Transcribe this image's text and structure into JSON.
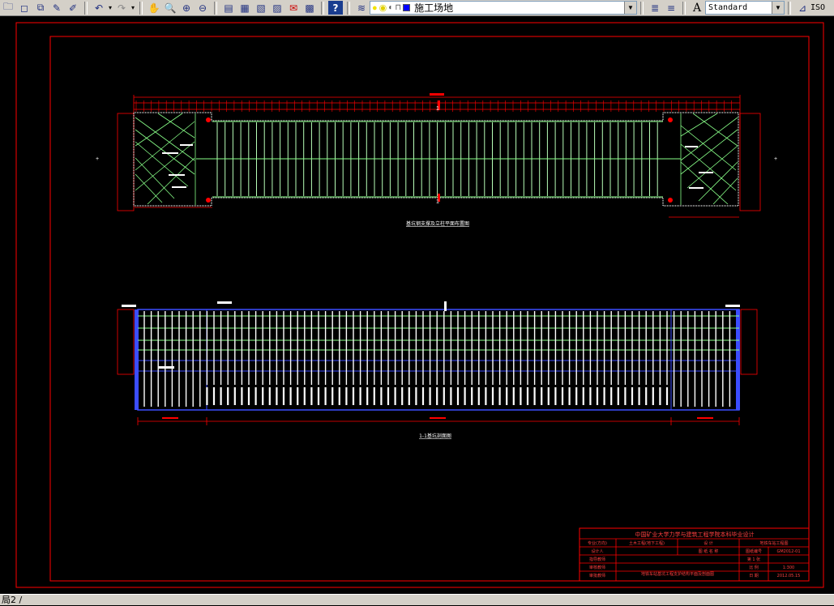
{
  "toolbar": {
    "layer_name": "施工场地",
    "text_style": "Standard",
    "dim_style": "ISO",
    "colors": {
      "bulb": "#f2e200",
      "sun": "#e0d000",
      "swatch": "#0000ff"
    }
  },
  "drawing": {
    "plan_title": "基坑钢支撑及立柱平面布置图",
    "section_title": "1-1基坑剖面图",
    "title_block": {
      "school": "中国矿业大学力学与建筑工程学院本科毕业设计",
      "cells": [
        "专业(方向)",
        "土木工程(地下工程)",
        "设 计",
        "地铁车站工程图",
        "设计人",
        "图 纸 名 称",
        "图纸编号",
        "GM2012-01",
        "指导教师",
        "",
        "第 1 张",
        "",
        "审核教师",
        "地铁车站基坑工程支护结构平面及剖面图",
        "比 例",
        "1:300",
        "审批教师",
        "日 期",
        "2012.05.15"
      ]
    }
  },
  "status": {
    "layout_tab": "局2 /"
  }
}
